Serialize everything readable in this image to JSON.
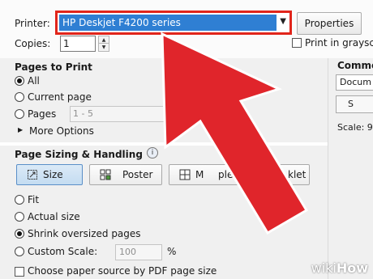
{
  "top": {
    "printer_label": "Printer:",
    "printer_value": "HP Deskjet F4200 series",
    "properties_label": "Properties",
    "copies_label": "Copies:",
    "copies_value": "1",
    "print_grayscale_label": "Print in grayscale"
  },
  "pages_to_print": {
    "title": "Pages to Print",
    "options": [
      "All",
      "Current page",
      "Pages"
    ],
    "selected": "All",
    "pages_range": "1 - 5",
    "more_options_label": "More Options"
  },
  "page_sizing": {
    "title": "Page Sizing & Handling",
    "info_icon": "i",
    "buttons": [
      "Size",
      "Poster",
      "Multiple",
      "Booklet"
    ],
    "visible_button_text": [
      "Size",
      "Poster",
      "M",
      "ple",
      "klet"
    ],
    "selected_button": "Size",
    "fit_options": [
      "Fit",
      "Actual size",
      "Shrink oversized pages",
      "Custom Scale:"
    ],
    "selected_fit": "Shrink oversized pages",
    "custom_scale_value": "100",
    "custom_scale_unit": "%",
    "paper_source_label": "Choose paper source by PDF page size"
  },
  "comments": {
    "title": "Comme",
    "select_value": "Docum",
    "summarize_label": "S",
    "scale_label": "Scale: 9"
  },
  "overlay": {
    "arrow_color": "#e0252b",
    "arrow_outline": "#ffffff"
  },
  "watermark": {
    "wiki": "wiki",
    "how": "How"
  }
}
